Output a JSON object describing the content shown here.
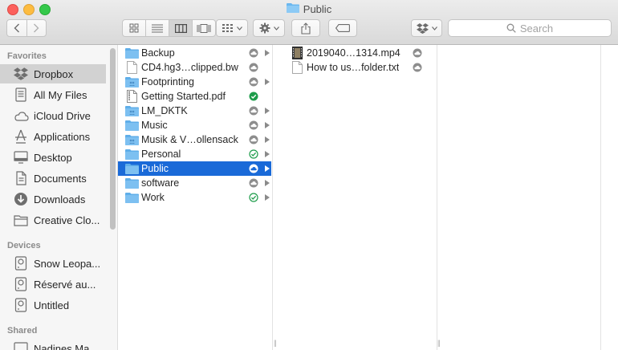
{
  "window": {
    "title": "Public"
  },
  "toolbar": {
    "back_icon": "chevron-left-icon",
    "forward_icon": "chevron-right-icon",
    "view_modes": [
      "icon-view-icon",
      "list-view-icon",
      "column-view-icon",
      "coverflow-view-icon"
    ],
    "active_view": "column",
    "search_placeholder": "Search"
  },
  "sidebar": {
    "favorites_heading": "Favorites",
    "favorites": [
      {
        "label": "Dropbox",
        "icon": "dropbox-icon",
        "selected": true
      },
      {
        "label": "All My Files",
        "icon": "all-files-icon"
      },
      {
        "label": "iCloud Drive",
        "icon": "cloud-icon"
      },
      {
        "label": "Applications",
        "icon": "applications-icon"
      },
      {
        "label": "Desktop",
        "icon": "desktop-icon"
      },
      {
        "label": "Documents",
        "icon": "documents-icon"
      },
      {
        "label": "Downloads",
        "icon": "downloads-icon"
      },
      {
        "label": "Creative Clo...",
        "icon": "folder-icon"
      }
    ],
    "devices_heading": "Devices",
    "devices": [
      {
        "label": "Snow Leopa...",
        "icon": "disk-icon"
      },
      {
        "label": "Réservé au...",
        "icon": "disk-icon"
      },
      {
        "label": "Untitled",
        "icon": "disk-icon"
      }
    ],
    "shared_heading": "Shared",
    "shared": [
      {
        "label": "Nadines Ma...",
        "icon": "computer-icon"
      }
    ]
  },
  "column1": {
    "items": [
      {
        "name": "Backup",
        "type": "folder",
        "status": "cloud",
        "arrow": true
      },
      {
        "name": "CD4.hg3…clipped.bw",
        "type": "file",
        "status": "cloud",
        "arrow": false
      },
      {
        "name": "Footprinting",
        "type": "folder-shared",
        "status": "cloud",
        "arrow": true
      },
      {
        "name": "Getting Started.pdf",
        "type": "pdf",
        "status": "synced-filled",
        "arrow": false
      },
      {
        "name": "LM_DKTK",
        "type": "folder-shared",
        "status": "cloud",
        "arrow": true
      },
      {
        "name": "Music",
        "type": "folder",
        "status": "cloud",
        "arrow": true
      },
      {
        "name": "Musik & V…ollensack",
        "type": "folder-shared",
        "status": "cloud",
        "arrow": true
      },
      {
        "name": "Personal",
        "type": "folder",
        "status": "synced",
        "arrow": true
      },
      {
        "name": "Public",
        "type": "folder",
        "status": "cloud",
        "arrow": true,
        "selected": true
      },
      {
        "name": "software",
        "type": "folder",
        "status": "cloud",
        "arrow": true
      },
      {
        "name": "Work",
        "type": "folder",
        "status": "synced",
        "arrow": true
      }
    ]
  },
  "column2": {
    "items": [
      {
        "name": "2019040…1314.mp4",
        "type": "video",
        "status": "cloud"
      },
      {
        "name": "How to us…folder.txt",
        "type": "file",
        "status": "cloud"
      }
    ]
  },
  "colors": {
    "selection": "#1a6ad8",
    "folder": "#6ab7ef",
    "synced": "#1d9c4a"
  }
}
